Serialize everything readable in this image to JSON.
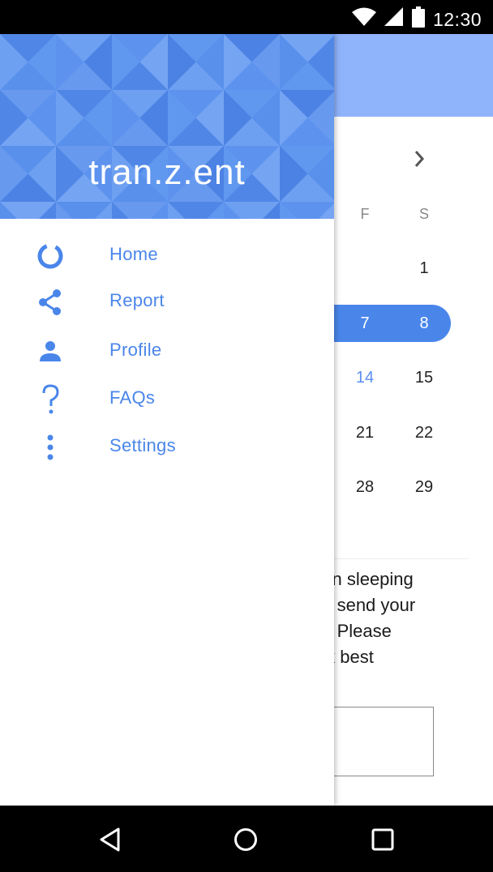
{
  "status_bar": {
    "time": "12:30",
    "icons": [
      "wifi-icon",
      "cellular-signal-icon",
      "battery-icon"
    ]
  },
  "drawer": {
    "title": "tran.z.ent",
    "items": [
      {
        "label": "Home",
        "icon": "donut-icon"
      },
      {
        "label": "Report",
        "icon": "share-icon"
      },
      {
        "label": "Profile",
        "icon": "person-icon"
      },
      {
        "label": "FAQs",
        "icon": "question-mark-icon"
      },
      {
        "label": "Settings",
        "icon": "more-vertical-icon"
      }
    ]
  },
  "background": {
    "calendar": {
      "next_icon": "chevron-right-icon",
      "weekdays": [
        "F",
        "S"
      ],
      "rows": [
        [
          "",
          "1"
        ],
        [
          "7",
          "8"
        ],
        [
          "14",
          "15"
        ],
        [
          "21",
          "22"
        ],
        [
          "28",
          "29"
        ]
      ],
      "selected_days": [
        "7",
        "8"
      ],
      "today": "14"
    },
    "text_lines": [
      "een sleeping",
      "ou send your",
      "er. Please",
      "ink best"
    ]
  },
  "nav_bar": {
    "buttons": [
      "back-icon",
      "home-icon",
      "recents-icon"
    ]
  },
  "colors": {
    "accent": "#4a86ea",
    "header": "#5b90ea",
    "appbar": "#90b4fb"
  }
}
